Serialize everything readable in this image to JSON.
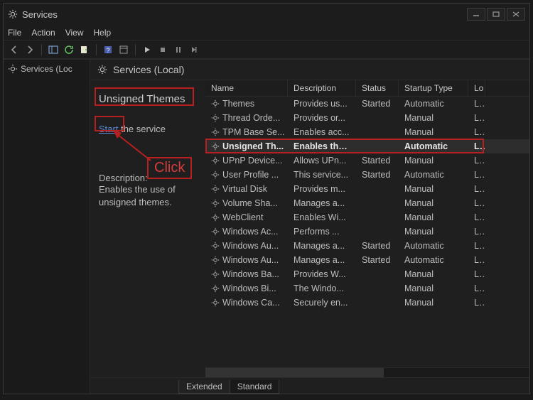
{
  "title": "Services",
  "menus": {
    "file": "File",
    "action": "Action",
    "view": "View",
    "help": "Help"
  },
  "tree": {
    "item": "Services (Loc"
  },
  "heading": "Services (Local)",
  "detail": {
    "selected_title": "Unsigned Themes",
    "start_label": "Start",
    "start_rest": " the service",
    "desc_label": "Description:",
    "desc_text": "Enables the use of unsigned themes."
  },
  "columns": {
    "name": "Name",
    "desc": "Description",
    "status": "Status",
    "startup": "Startup Type",
    "logon": "Lo"
  },
  "rows": [
    {
      "name": "Themes",
      "desc": "Provides us...",
      "status": "Started",
      "startup": "Automatic",
      "logon": "Lc"
    },
    {
      "name": "Thread Orde...",
      "desc": "Provides or...",
      "status": "",
      "startup": "Manual",
      "logon": "Lc"
    },
    {
      "name": "TPM Base Se...",
      "desc": "Enables acc...",
      "status": "",
      "startup": "Manual",
      "logon": "Lc"
    },
    {
      "name": "Unsigned Th...",
      "desc": "Enables the...",
      "status": "",
      "startup": "Automatic",
      "logon": "Lc",
      "selected": true
    },
    {
      "name": "UPnP Device...",
      "desc": "Allows UPn...",
      "status": "Started",
      "startup": "Manual",
      "logon": "Lc"
    },
    {
      "name": "User Profile ...",
      "desc": "This service...",
      "status": "Started",
      "startup": "Automatic",
      "logon": "Lc"
    },
    {
      "name": "Virtual Disk",
      "desc": "Provides m...",
      "status": "",
      "startup": "Manual",
      "logon": "Lc"
    },
    {
      "name": "Volume Sha...",
      "desc": "Manages a...",
      "status": "",
      "startup": "Manual",
      "logon": "Lc"
    },
    {
      "name": "WebClient",
      "desc": "Enables Wi...",
      "status": "",
      "startup": "Manual",
      "logon": "Lc"
    },
    {
      "name": "Windows Ac...",
      "desc": "Performs ...",
      "status": "",
      "startup": "Manual",
      "logon": "Lc"
    },
    {
      "name": "Windows Au...",
      "desc": "Manages a...",
      "status": "Started",
      "startup": "Automatic",
      "logon": "Lc"
    },
    {
      "name": "Windows Au...",
      "desc": "Manages a...",
      "status": "Started",
      "startup": "Automatic",
      "logon": "Lc"
    },
    {
      "name": "Windows Ba...",
      "desc": "Provides W...",
      "status": "",
      "startup": "Manual",
      "logon": "Lc"
    },
    {
      "name": "Windows Bi...",
      "desc": "The Windo...",
      "status": "",
      "startup": "Manual",
      "logon": "Lc"
    },
    {
      "name": "Windows Ca...",
      "desc": "Securely en...",
      "status": "",
      "startup": "Manual",
      "logon": "Lc"
    }
  ],
  "tabs": {
    "extended": "Extended",
    "standard": "Standard"
  },
  "annotation": {
    "click_label": "Click"
  }
}
